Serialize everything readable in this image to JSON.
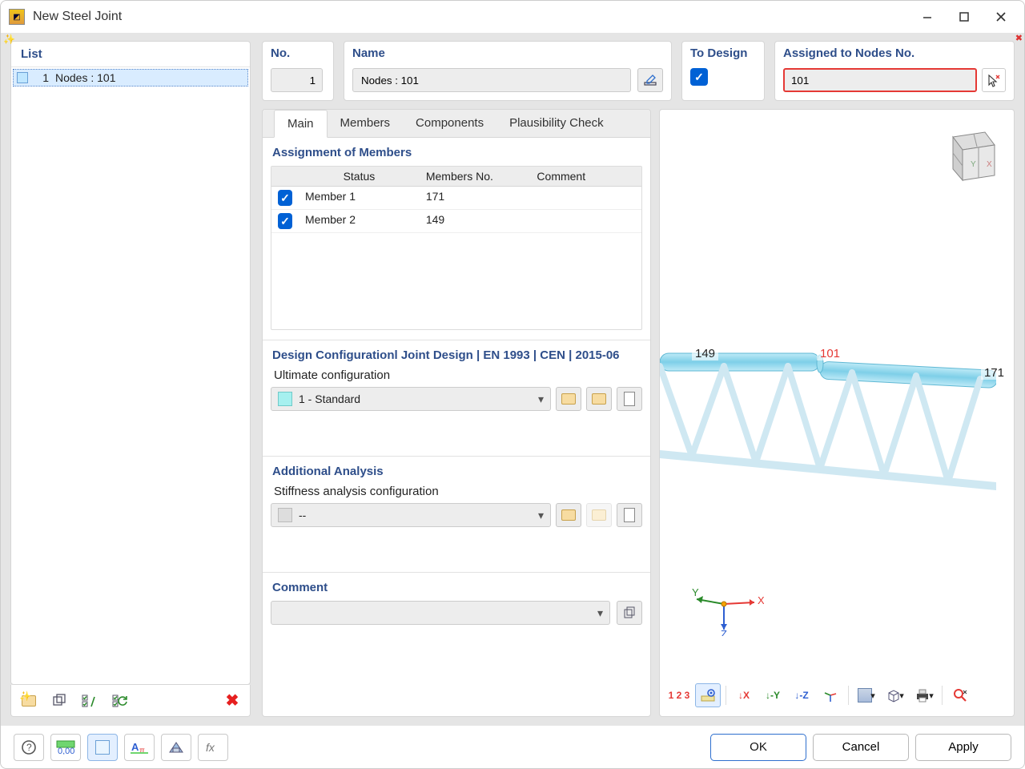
{
  "window": {
    "title": "New Steel Joint"
  },
  "list": {
    "label": "List",
    "items": [
      {
        "index": "1",
        "text": "Nodes : 101"
      }
    ]
  },
  "header": {
    "no_label": "No.",
    "no_value": "1",
    "name_label": "Name",
    "name_value": "Nodes : 101",
    "to_design_label": "To Design",
    "assigned_label": "Assigned to Nodes No.",
    "assigned_value": "101"
  },
  "tabs": {
    "main": "Main",
    "members": "Members",
    "components": "Components",
    "plausibility": "Plausibility Check"
  },
  "assignment": {
    "title": "Assignment of Members",
    "col_status": "Status",
    "col_no": "Members No.",
    "col_comment": "Comment",
    "rows": [
      {
        "status": "Member 1",
        "no": "171",
        "comment": ""
      },
      {
        "status": "Member 2",
        "no": "149",
        "comment": ""
      }
    ]
  },
  "design": {
    "title": "Design Configurationl Joint Design | EN 1993 | CEN | 2015-06",
    "ultimate_label": "Ultimate configuration",
    "ultimate_value": "1 - Standard"
  },
  "additional": {
    "title": "Additional Analysis",
    "stiffness_label": "Stiffness analysis configuration",
    "stiffness_value": "--"
  },
  "comment": {
    "title": "Comment",
    "value": ""
  },
  "preview": {
    "node_left": "149",
    "node_mid": "101",
    "node_right": "171",
    "axis_x": "X",
    "axis_y": "Y",
    "axis_z": "Z"
  },
  "buttons": {
    "ok": "OK",
    "cancel": "Cancel",
    "apply": "Apply"
  }
}
